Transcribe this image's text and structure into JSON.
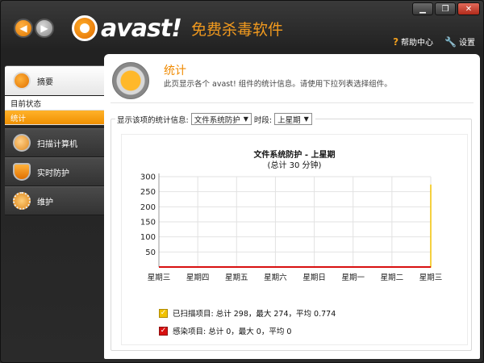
{
  "app": {
    "logo_text": "avast!",
    "tagline": "免费杀毒软件",
    "help_label": "帮助中心",
    "settings_label": "设置"
  },
  "sidebar": {
    "items": [
      {
        "label": "摘要"
      },
      {
        "label": "扫描计算机"
      },
      {
        "label": "实时防护"
      },
      {
        "label": "维护"
      }
    ],
    "subitems": [
      {
        "label": "目前状态"
      },
      {
        "label": "统计"
      }
    ]
  },
  "main": {
    "title": "统计",
    "description": "此页显示各个 avast! 组件的统计信息。请使用下拉列表选择组件。",
    "filter_label": "显示该项的统计信息:",
    "component_value": "文件系统防护",
    "period_label": "时段:",
    "period_value": "上星期"
  },
  "chart_data": {
    "type": "line",
    "title": "文件系统防护 - 上星期",
    "subtitle": "(总计 30 分钟)",
    "categories": [
      "星期三",
      "星期四",
      "星期五",
      "星期六",
      "星期日",
      "星期一",
      "星期二",
      "星期三"
    ],
    "y_ticks": [
      50,
      100,
      150,
      200,
      250,
      300
    ],
    "ylim": [
      0,
      300
    ],
    "grid": true,
    "series": [
      {
        "name": "已扫描项目",
        "color": "#f2c200",
        "values": [
          0,
          0,
          0,
          0,
          0,
          0,
          0,
          274
        ]
      },
      {
        "name": "感染项目",
        "color": "#d81010",
        "values": [
          0,
          0,
          0,
          0,
          0,
          0,
          0,
          0
        ]
      }
    ],
    "legend": [
      {
        "text": "已扫描项目:  总计 298，最大 274，平均 0.774",
        "color": "#f2c200"
      },
      {
        "text": "感染项目:  总计 0，最大 0，平均 0",
        "color": "#d81010"
      }
    ]
  }
}
